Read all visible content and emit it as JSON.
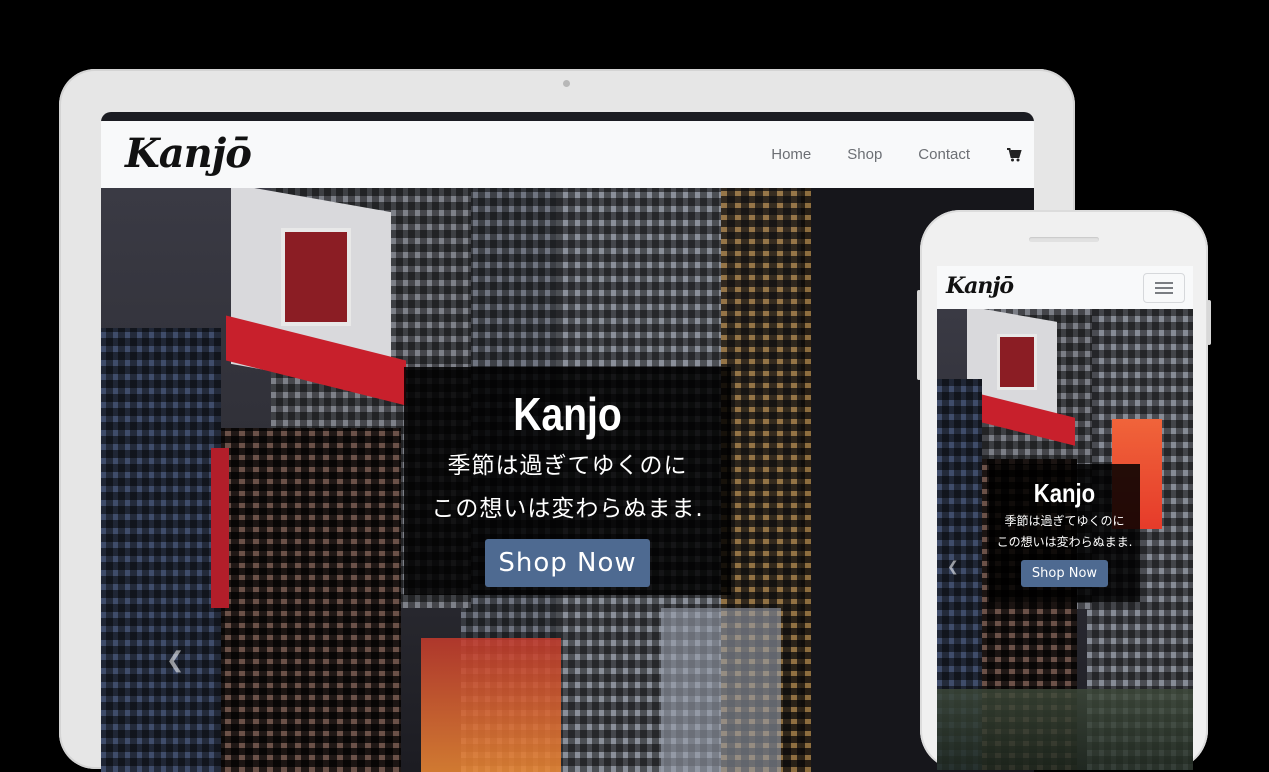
{
  "brand": {
    "logo_text": "Kanjō"
  },
  "nav": {
    "links": [
      {
        "label": "Home"
      },
      {
        "label": "Shop"
      },
      {
        "label": "Contact"
      }
    ],
    "cart_icon": "shopping-cart-icon",
    "menu_icon": "hamburger-menu-icon"
  },
  "hero": {
    "title": "Kanjo",
    "line1": "季節は過ぎてゆくのに",
    "line2": "この想いは変わらぬまま.",
    "button_label": "Shop Now"
  },
  "colors": {
    "navbar_bg": "#f8f9fa",
    "nav_text": "#6c6f74",
    "caption_bg": "#000000",
    "button_bg": "#4e6a91",
    "device_frame": "#e6e6e6"
  }
}
